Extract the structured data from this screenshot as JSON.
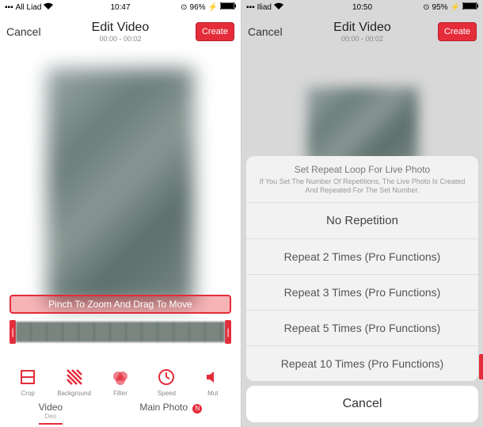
{
  "left": {
    "status": {
      "carrier": "All Liad",
      "time": "10:47",
      "battery": "96%"
    },
    "nav": {
      "cancel": "Cancel",
      "title": "Edit Video",
      "subtitle": "00:00 - 00:02",
      "create": "Create"
    },
    "hint": "Pinch To Zoom And Drag To Move",
    "tools": [
      {
        "label": "Crop",
        "icon": "crop"
      },
      {
        "label": "Background",
        "icon": "pattern"
      },
      {
        "label": "Filter",
        "icon": "filter"
      },
      {
        "label": "Speed",
        "icon": "speed"
      },
      {
        "label": "Mut",
        "icon": "mute"
      }
    ],
    "tabs": {
      "video": "Video",
      "video_sub": "Deo",
      "main": "Main Photo",
      "badge": "N"
    }
  },
  "right": {
    "status": {
      "carrier": "Iliad",
      "time": "10:50",
      "battery": "95%"
    },
    "nav": {
      "cancel": "Cancel",
      "title": "Edit Video",
      "subtitle": "00:00 - 00:02",
      "create": "Create"
    },
    "sheet": {
      "title": "Set Repeat Loop For Live Photo",
      "desc": "If You Set The Number Of Repetitions, The Live Photo Is Created And Repeated For The Set Number.",
      "options": [
        "No Repetition",
        "Repeat 2 Times (Pro Functions)",
        "Repeat 3 Times (Pro Functions)",
        "Repeat 5 Times (Pro Functions)",
        "Repeat 10 Times (Pro Functions)"
      ],
      "cancel": "Cancel"
    }
  }
}
